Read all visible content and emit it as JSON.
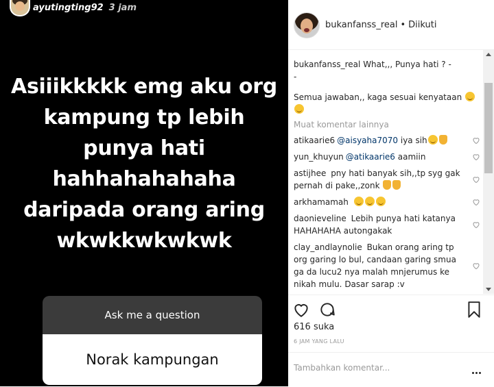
{
  "story": {
    "username": "ayutingting92",
    "time": "3 jam",
    "text_lines": [
      "Asiiikkkkk emg aku org",
      "kampung tp lebih",
      "punya hati",
      "hahhahahahaha",
      "daripada orang aring",
      "wkwkkwkwkwk"
    ],
    "question_prompt": "Ask me a question",
    "question_answer": "Norak kampungan"
  },
  "post": {
    "username": "bukanfanss_real",
    "separator": "•",
    "follow_status": "Diikuti",
    "caption_user": "bukanfanss_real",
    "caption_line1": "What,,, Punya hati ? -",
    "caption_line2": "-",
    "caption_line3": "Semua jawaban,, kaga sesuai kenyataan",
    "more_comments": "Muat komentar lainnya",
    "comments": [
      {
        "user": "atikaarie6",
        "mention": "@aisyaha7070",
        "text": "iya sih"
      },
      {
        "user": "yun_khuyun",
        "mention": "@atikaarie6",
        "text": "aamiin"
      },
      {
        "user": "astijhee",
        "mention": "",
        "text": "pny hati banyak sih,,tp syg gak pernah di pake,,zonk"
      },
      {
        "user": "arkhamamah",
        "mention": "",
        "text": ""
      },
      {
        "user": "daonieveline",
        "mention": "",
        "text": "Lebih punya hati katanya HAHAHAHA autongakak"
      },
      {
        "user": "clay_andlaynolie",
        "mention": "",
        "text": "Bukan orang aring tp org garing lo bul, candaan garing smua ga da lucu2 nya malah mnjerumus ke nikah mulu. Dasar sarap :v"
      }
    ],
    "likes": "616 suka",
    "time_ago": "6 JAM YANG LALU",
    "add_comment_placeholder": "Tambahkan komentar..."
  },
  "icons": [
    "heart-icon",
    "comment-icon",
    "bookmark-icon",
    "more-icon"
  ]
}
